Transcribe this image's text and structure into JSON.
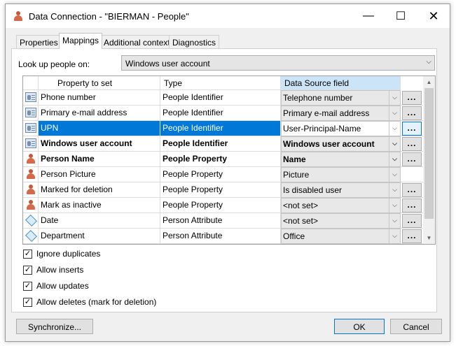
{
  "window": {
    "title": "Data Connection - \"BIERMAN - People\"",
    "controls": {
      "minimize": "—",
      "maximize": "☐",
      "close": "✕"
    }
  },
  "tabs": [
    {
      "label": "Properties",
      "active": false
    },
    {
      "label": "Mappings",
      "active": true
    },
    {
      "label": "Additional context",
      "active": false
    },
    {
      "label": "Diagnostics",
      "active": false
    }
  ],
  "lookup": {
    "label": "Look up people on:",
    "value": "Windows user account"
  },
  "grid": {
    "columns": [
      "Property to set",
      "Type",
      "Data Source field"
    ],
    "rows": [
      {
        "icon": "id-card-icon",
        "property": "Phone number",
        "type": "People Identifier",
        "source": "Telephone number",
        "dots": "...",
        "bold": false,
        "selected": false,
        "has_button": true
      },
      {
        "icon": "id-card-icon",
        "property": "Primary e-mail address",
        "type": "People Identifier",
        "source": "Primary e-mail address",
        "dots": "...",
        "bold": false,
        "selected": false,
        "has_button": true
      },
      {
        "icon": "id-card-icon",
        "property": "UPN",
        "type": "People Identifier",
        "source": "User-Principal-Name",
        "dots": "...",
        "bold": false,
        "selected": true,
        "has_button": true
      },
      {
        "icon": "id-card-icon",
        "property": "Windows user account",
        "type": "People Identifier",
        "source": "Windows user account",
        "dots": "...",
        "bold": true,
        "selected": false,
        "has_button": true
      },
      {
        "icon": "person-icon",
        "property": "Person Name",
        "type": "People Property",
        "source": "Name",
        "dots": "...",
        "bold": true,
        "selected": false,
        "has_button": true
      },
      {
        "icon": "person-icon",
        "property": "Person Picture",
        "type": "People Property",
        "source": "Picture",
        "dots": "",
        "bold": false,
        "selected": false,
        "has_button": false
      },
      {
        "icon": "person-icon",
        "property": "Marked for deletion",
        "type": "People Property",
        "source": "Is disabled user",
        "dots": "...",
        "bold": false,
        "selected": false,
        "has_button": true
      },
      {
        "icon": "person-icon",
        "property": "Mark as inactive",
        "type": "People Property",
        "source": "<not set>",
        "dots": "...",
        "bold": false,
        "selected": false,
        "has_button": true
      },
      {
        "icon": "tag-icon",
        "property": "Date",
        "type": "Person Attribute",
        "source": "<not set>",
        "dots": "...",
        "bold": false,
        "selected": false,
        "has_button": true
      },
      {
        "icon": "tag-icon",
        "property": "Department",
        "type": "Person Attribute",
        "source": "Office",
        "dots": "...",
        "bold": false,
        "selected": false,
        "has_button": true
      }
    ]
  },
  "options": [
    {
      "label": "Ignore duplicates",
      "checked": true
    },
    {
      "label": "Allow inserts",
      "checked": true
    },
    {
      "label": "Allow updates",
      "checked": true
    },
    {
      "label": "Allow deletes (mark for deletion)",
      "checked": true
    }
  ],
  "buttons": {
    "synchronize": "Synchronize...",
    "ok": "OK",
    "cancel": "Cancel"
  },
  "colors": {
    "selection": "#0078d7",
    "header_highlight": "#cce4f7",
    "person_icon": "#d46a4a"
  }
}
